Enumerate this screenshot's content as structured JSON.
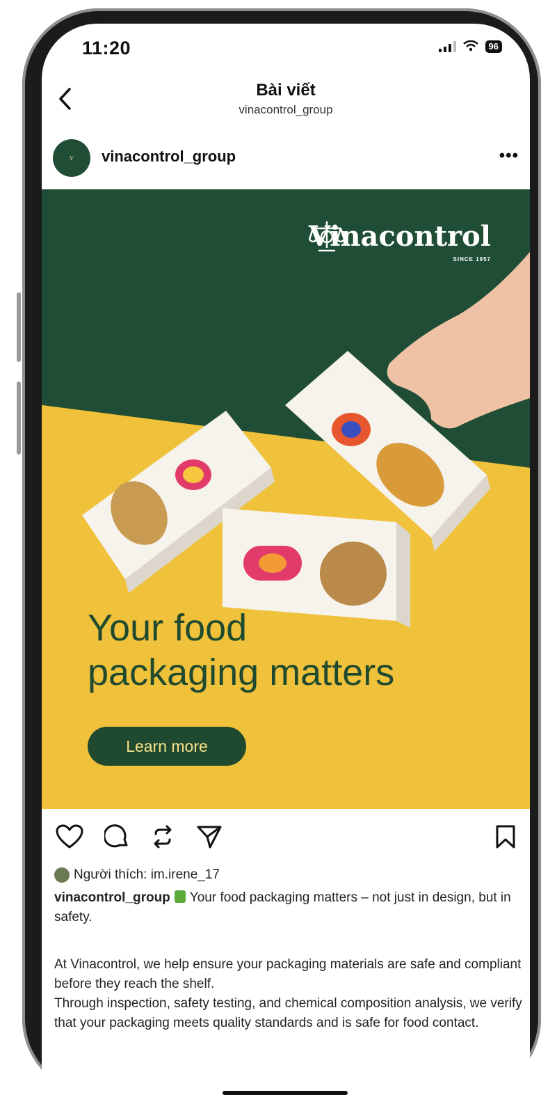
{
  "status": {
    "time": "11:20",
    "battery": "96"
  },
  "header": {
    "title": "Bài viết",
    "subtitle": "vinacontrol_group"
  },
  "post": {
    "username": "vinacontrol_group",
    "more_label": "•••",
    "image": {
      "brand": "Vinacontrol",
      "since": "SINCE 1957",
      "headline_line1": "Your food",
      "headline_line2": "packaging matters",
      "cta": "Learn more"
    },
    "likes_text": "Người thích: im.irene_17",
    "caption_user": "vinacontrol_group",
    "caption_text": "Your food packaging matters – not just in design, but in safety.",
    "body": "At Vinacontrol, we help ensure your packaging materials are safe and compliant before they reach the shelf.\nThrough inspection, safety testing, and chemical composition analysis, we verify that your packaging meets quality standards and is safe for food contact."
  },
  "icons": [
    "back-icon",
    "heart-icon",
    "comment-icon",
    "repost-icon",
    "share-icon",
    "bookmark-icon",
    "more-icon"
  ],
  "colors": {
    "brand_green": "#1f4a2f",
    "brand_yellow": "#f0c13a"
  }
}
